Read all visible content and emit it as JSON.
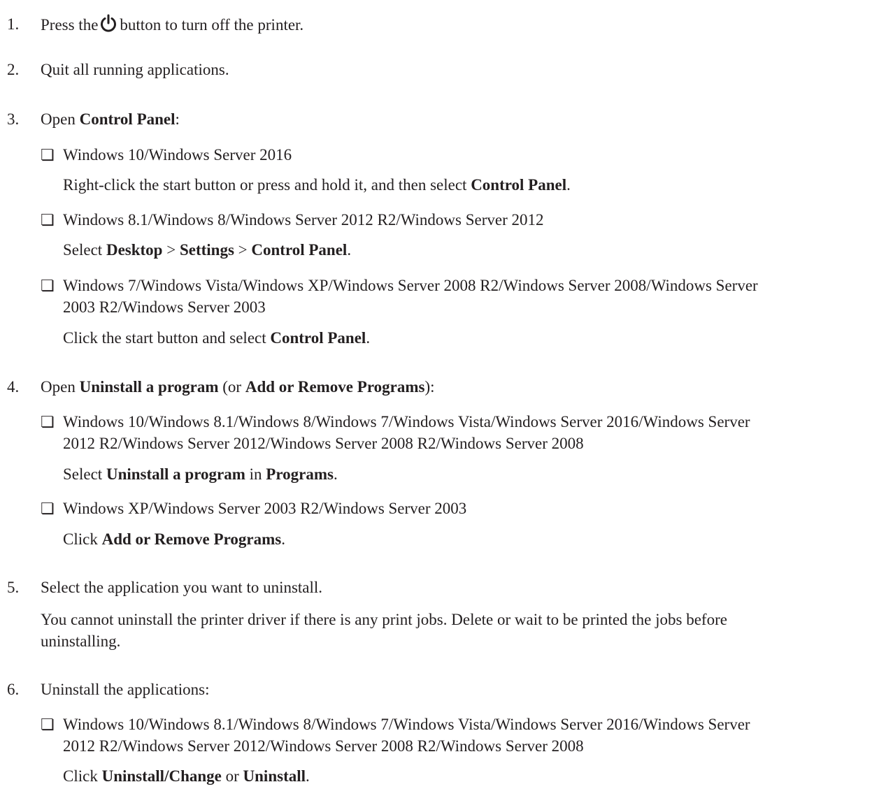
{
  "steps": [
    {
      "number": "1.",
      "parts": [
        "Press the",
        "button to turn off the printer."
      ],
      "icon": "power-icon"
    },
    {
      "number": "2.",
      "text": "Quit all running applications."
    },
    {
      "number": "3.",
      "parts": [
        "Open ",
        "Control Panel",
        ":"
      ],
      "options": [
        {
          "bullet": "❏",
          "heading": "Windows 10/Windows Server 2016",
          "instruction": [
            "Right-click the start button or press and hold it, and then select ",
            "Control Panel",
            "."
          ]
        },
        {
          "bullet": "❏",
          "heading": "Windows 8.1/Windows 8/Windows Server 2012 R2/Windows Server 2012",
          "instruction": [
            "Select ",
            "Desktop",
            " > ",
            "Settings",
            " > ",
            "Control Panel",
            "."
          ]
        },
        {
          "bullet": "❏",
          "heading_lines": [
            "Windows 7/Windows Vista/Windows XP/Windows Server 2008 R2/Windows Server 2008/Windows Server",
            "2003 R2/Windows Server 2003"
          ],
          "instruction": [
            "Click the start button and select ",
            "Control Panel",
            "."
          ]
        }
      ]
    },
    {
      "number": "4.",
      "parts": [
        "Open ",
        "Uninstall a program",
        " (or ",
        "Add or Remove Programs",
        "):"
      ],
      "options": [
        {
          "bullet": "❏",
          "heading_lines": [
            "Windows 10/Windows 8.1/Windows 8/Windows 7/Windows Vista/Windows Server 2016/Windows Server",
            "2012 R2/Windows Server 2012/Windows Server 2008 R2/Windows Server 2008"
          ],
          "instruction": [
            "Select ",
            "Uninstall a program",
            " in ",
            "Programs",
            "."
          ]
        },
        {
          "bullet": "❏",
          "heading": "Windows XP/Windows Server 2003 R2/Windows Server 2003",
          "instruction": [
            "Click ",
            "Add or Remove Programs",
            "."
          ]
        }
      ]
    },
    {
      "number": "5.",
      "text": "Select the application you want to uninstall.",
      "note_lines": [
        "You cannot uninstall the printer driver if there is any print jobs. Delete or wait to be printed the jobs before",
        "uninstalling."
      ]
    },
    {
      "number": "6.",
      "text": "Uninstall the applications:",
      "options": [
        {
          "bullet": "❏",
          "heading_lines": [
            "Windows 10/Windows 8.1/Windows 8/Windows 7/Windows Vista/Windows Server 2016/Windows Server",
            "2012 R2/Windows Server 2012/Windows Server 2008 R2/Windows Server 2008"
          ],
          "instruction": [
            "Click ",
            "Uninstall/Change",
            " or ",
            "Uninstall",
            "."
          ]
        }
      ]
    }
  ]
}
